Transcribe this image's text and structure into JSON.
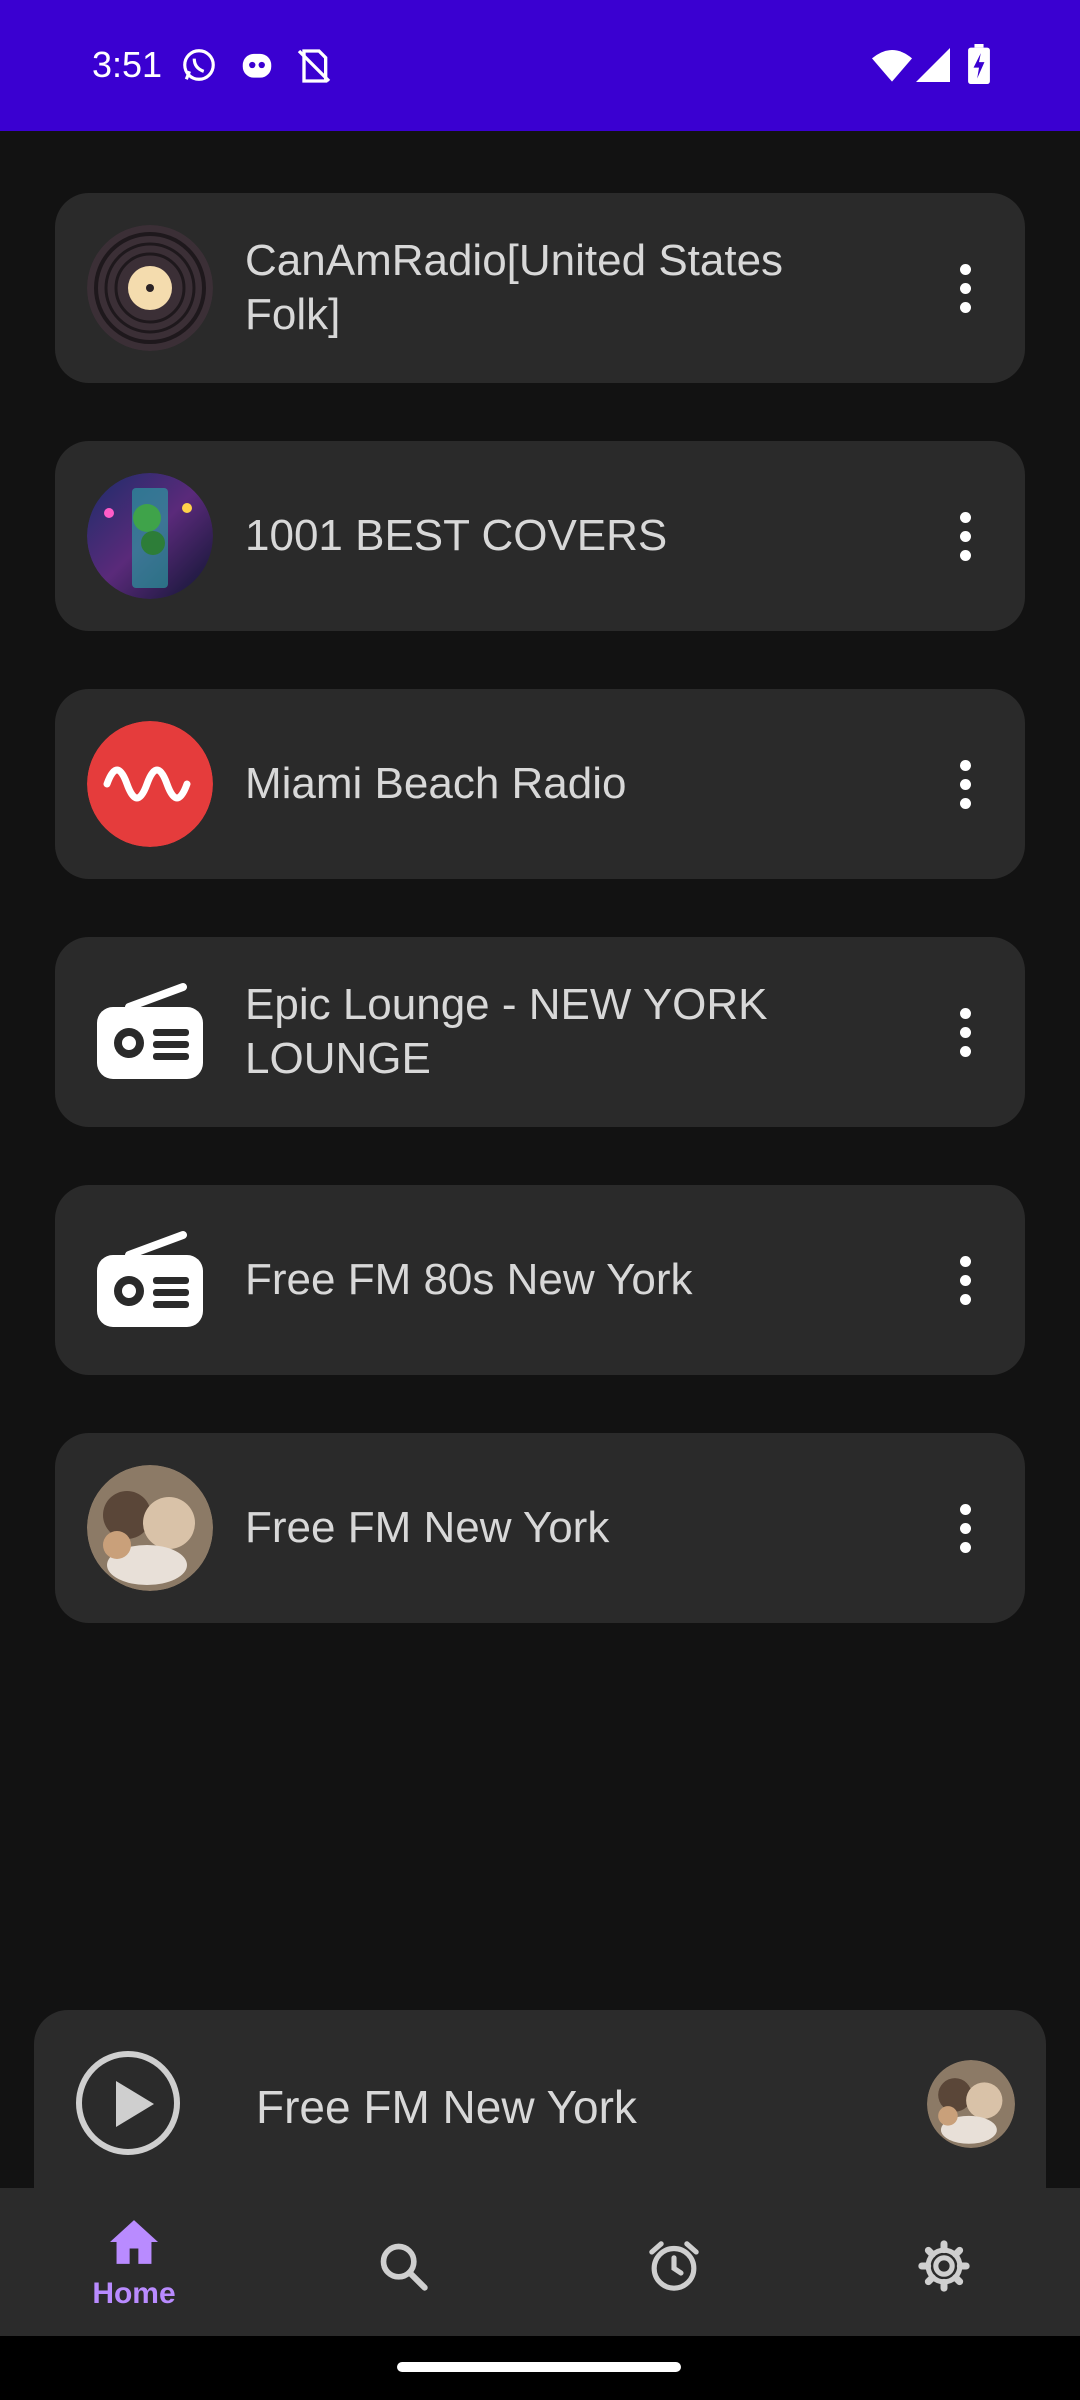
{
  "status_bar": {
    "time": "3:51",
    "left_icons": [
      "whatsapp-icon",
      "robot-icon",
      "no-sim-icon"
    ],
    "right_icons": [
      "wifi-icon",
      "signal-icon",
      "battery-charging-icon"
    ],
    "background": "#3a00d1"
  },
  "stations": [
    {
      "name": "CanAmRadio[United States Folk]",
      "icon": "vinyl-record-icon"
    },
    {
      "name": "1001 BEST COVERS",
      "icon": "station-logo-image"
    },
    {
      "name": "Miami Beach Radio",
      "icon": "sound-wave-icon"
    },
    {
      "name": "Epic Lounge - NEW YORK LOUNGE",
      "icon": "radio-icon"
    },
    {
      "name": "Free FM 80s New York",
      "icon": "radio-icon"
    },
    {
      "name": "Free FM New York",
      "icon": "station-photo-image"
    }
  ],
  "mini_player": {
    "title": "Free FM New York",
    "icon": "play-icon"
  },
  "bottom_nav": {
    "items": [
      {
        "label": "Home",
        "icon": "home-icon",
        "active": true
      },
      {
        "label": "",
        "icon": "search-icon",
        "active": false
      },
      {
        "label": "",
        "icon": "alarm-icon",
        "active": false
      },
      {
        "label": "",
        "icon": "settings-icon",
        "active": false
      }
    ],
    "active_color": "#b98bff"
  }
}
